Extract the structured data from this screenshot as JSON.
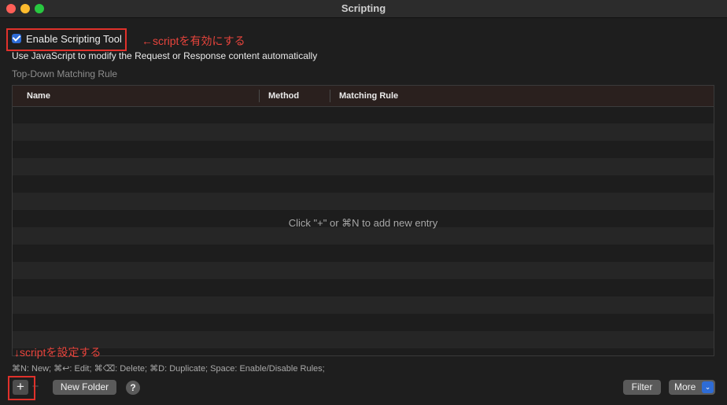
{
  "window": {
    "title": "Scripting"
  },
  "settings": {
    "enable_label": "Enable Scripting Tool",
    "enabled": true,
    "description": "Use JavaScript to modify the Request or Response content automatically",
    "section_label": "Top-Down Matching Rule"
  },
  "annotations": {
    "enable_note": "←scriptを有効にする",
    "add_note": "↓scriptを設定する",
    "color": "#e0312b"
  },
  "table": {
    "columns": [
      "Name",
      "Method",
      "Matching Rule"
    ],
    "rows": [],
    "empty_message": "Click \"+\" or ⌘N to add new entry"
  },
  "footer": {
    "shortcuts": "⌘N: New; ⌘↩: Edit; ⌘⌫: Delete; ⌘D: Duplicate; Space: Enable/Disable Rules;",
    "add_label": "+",
    "remove_label": "−",
    "new_folder_label": "New Folder",
    "help_label": "?",
    "filter_label": "Filter",
    "more_label": "More",
    "more_chevron": "⌄"
  },
  "colors": {
    "accent": "#2e6cd6",
    "background": "#1e1e1e"
  }
}
